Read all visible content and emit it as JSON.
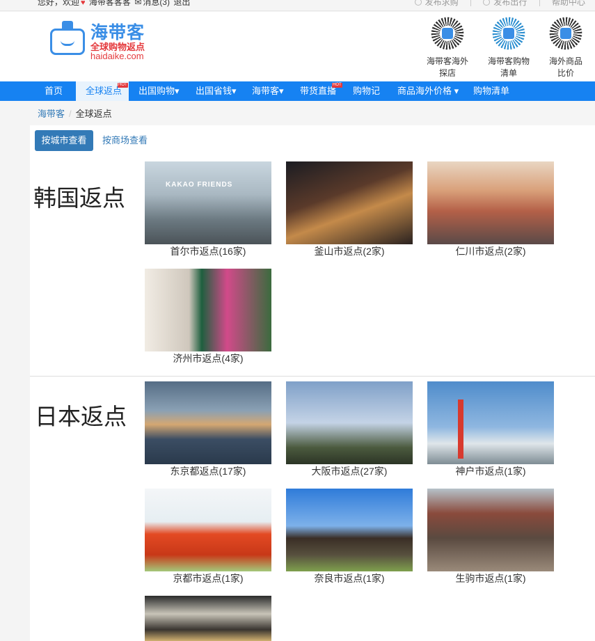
{
  "topbar": {
    "greeting": "您好，欢迎",
    "username": "海带客客客",
    "messages": "消息(3)",
    "logout": "退出",
    "links": [
      "发布求购",
      "发布出行",
      "帮助中心"
    ]
  },
  "logo": {
    "cn": "海带客",
    "sub": "全球购物返点",
    "en": "haidaike.com"
  },
  "qrcodes": [
    {
      "line1": "海带客海外",
      "line2": "探店"
    },
    {
      "line1": "海带客购物",
      "line2": "清单"
    },
    {
      "line1": "海外商品",
      "line2": "比价"
    }
  ],
  "nav": {
    "items": [
      {
        "label": "首页"
      },
      {
        "label": "全球返点"
      },
      {
        "label": "出国购物"
      },
      {
        "label": "出国省钱"
      },
      {
        "label": "海带客"
      },
      {
        "label": "带货直播"
      },
      {
        "label": "购物记"
      },
      {
        "label": "商品海外价格"
      },
      {
        "label": "购物清单"
      }
    ],
    "hot": "HOT",
    "caret": "▾"
  },
  "breadcrumb": {
    "home": "海带客",
    "current": "全球返点"
  },
  "view_toggle": {
    "by_city": "按城市查看",
    "by_mall": "按商场查看"
  },
  "sections": [
    {
      "title": "韩国返点",
      "cities": [
        "首尔市返点(16家)",
        "釜山市返点(2家)",
        "仁川市返点(2家)",
        "济州市返点(4家)"
      ]
    },
    {
      "title": "日本返点",
      "cities": [
        "东京都返点(17家)",
        "大阪市返点(27家)",
        "神户市返点(1家)",
        "京都市返点(1家)",
        "奈良市返点(1家)",
        "生驹市返点(1家)"
      ]
    }
  ],
  "colors": {
    "nav_bg": "#1682f2",
    "link": "#337ab7",
    "button_bg": "#337ab7",
    "hot": "#e4393c"
  }
}
